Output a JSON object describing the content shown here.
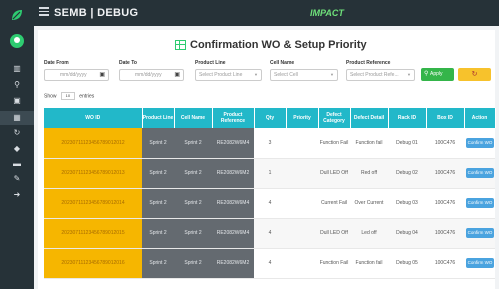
{
  "app": {
    "title": "SEMB | DEBUG",
    "brand": "IMPACT"
  },
  "sidebar": {
    "icons": [
      "logo-icon",
      "user-avatar",
      "dashboard-icon",
      "search-icon",
      "briefcase-icon",
      "table-icon",
      "refresh-icon",
      "tag-icon",
      "folder-icon",
      "wrench-icon",
      "signout-icon"
    ]
  },
  "page": {
    "title": "Confirmation WO & Setup Priority"
  },
  "filters": {
    "date_from_label": "Date From",
    "date_from_placeholder": "mm/dd/yyyy",
    "date_to_label": "Date To",
    "date_to_placeholder": "mm/dd/yyyy",
    "product_line_label": "Product Line",
    "product_line_placeholder": "Select Product Line",
    "cell_name_label": "Cell Name",
    "cell_name_placeholder": "Select Cell",
    "product_ref_label": "Product Reference",
    "product_ref_placeholder": "Select Product Refe...",
    "apply_label": "Apply",
    "reset_label": "↻"
  },
  "show": {
    "prefix": "Show",
    "value": "10",
    "suffix": "entries"
  },
  "table": {
    "headers": [
      "WO ID",
      "Product Line",
      "Cell Name",
      "Product Reference",
      "Qty",
      "Priority",
      "Defect Category",
      "Defect Detail",
      "Rack ID",
      "Box ID",
      "Action"
    ],
    "rows": [
      {
        "wo_id": "20230711123456789012012",
        "product_line": "Sprint 2",
        "cell_name": "Sprint 2",
        "product_ref": "RE2082W6M4",
        "qty": "3",
        "priority": "",
        "defect_category": "Function Fail",
        "defect_detail": "Function fail",
        "rack_id": "Debug 01",
        "box_id": "100C476",
        "action": "Confirm WO"
      },
      {
        "wo_id": "20230711123456789012013",
        "product_line": "Sprint 2",
        "cell_name": "Sprint 2",
        "product_ref": "RE2082W6M2",
        "qty": "1",
        "priority": "",
        "defect_category": "Dull LED Off",
        "defect_detail": "Red off",
        "rack_id": "Debug 02",
        "box_id": "100C476",
        "action": "Confirm WO"
      },
      {
        "wo_id": "20230711123456789012014",
        "product_line": "Sprint 2",
        "cell_name": "Sprint 2",
        "product_ref": "RE2082W6M4",
        "qty": "4",
        "priority": "",
        "defect_category": "Current Fail",
        "defect_detail": "Over Current",
        "rack_id": "Debug 03",
        "box_id": "100C476",
        "action": "Confirm WO"
      },
      {
        "wo_id": "20230711123456789012015",
        "product_line": "Sprint 2",
        "cell_name": "Sprint 2",
        "product_ref": "RE2082W6M4",
        "qty": "4",
        "priority": "",
        "defect_category": "Dull LED Off",
        "defect_detail": "Led off",
        "rack_id": "Debug 04",
        "box_id": "100C476",
        "action": "Confirm WO"
      },
      {
        "wo_id": "20230711123456789012016",
        "product_line": "Sprint 2",
        "cell_name": "Sprint 2",
        "product_ref": "RE2082W6M2",
        "qty": "4",
        "priority": "",
        "defect_category": "Function Fail",
        "defect_detail": "Function fail",
        "rack_id": "Debug 05",
        "box_id": "100C476",
        "action": "Confirm WO"
      }
    ]
  },
  "colors": {
    "sidebar_bg": "#263238",
    "header_teal": "#22b8c9",
    "wo_highlight": "#f6b600",
    "dark_cell": "#646a70",
    "confirm_blue": "#4aa3df",
    "apply_green": "#34b54a",
    "reset_yellow": "#f7c22c"
  }
}
